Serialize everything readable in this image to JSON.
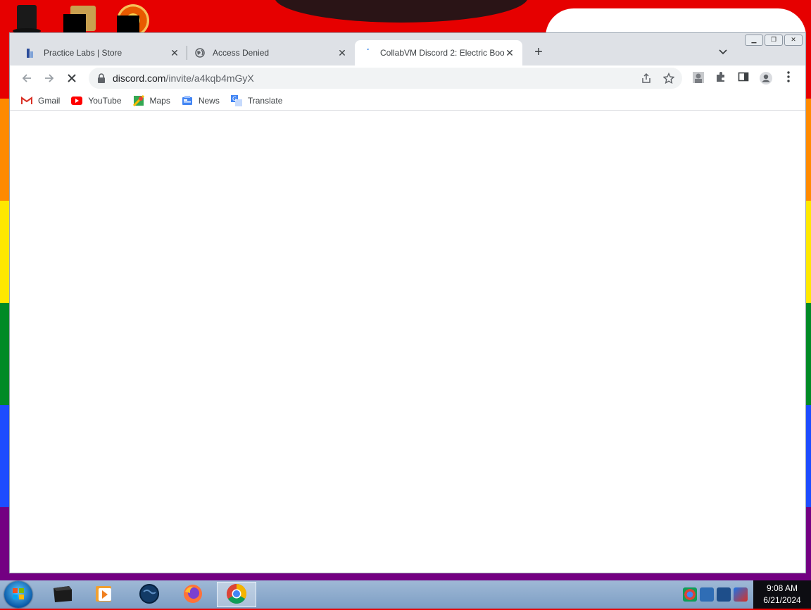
{
  "browser": {
    "tabs": [
      {
        "title": "Practice Labs | Store",
        "active": false,
        "favicon": "practice-labs-icon"
      },
      {
        "title": "Access Denied",
        "active": false,
        "favicon": "globe-icon"
      },
      {
        "title": "CollabVM Discord 2: Electric Boo",
        "active": true,
        "favicon": "loading-icon"
      }
    ],
    "new_tab": "+",
    "address": {
      "host": "discord.com",
      "path": "/invite/a4kqb4mGyX"
    },
    "bookmarks": [
      {
        "label": "Gmail",
        "icon": "gmail-icon"
      },
      {
        "label": "YouTube",
        "icon": "youtube-icon"
      },
      {
        "label": "Maps",
        "icon": "maps-icon"
      },
      {
        "label": "News",
        "icon": "news-icon"
      },
      {
        "label": "Translate",
        "icon": "translate-icon"
      }
    ]
  },
  "taskbar": {
    "time": "9:08 AM",
    "date": "6/21/2024"
  },
  "colors": {
    "tabstrip": "#dee1e6",
    "omnibox": "#f1f3f4",
    "clock_bg": "#0d0d12"
  }
}
